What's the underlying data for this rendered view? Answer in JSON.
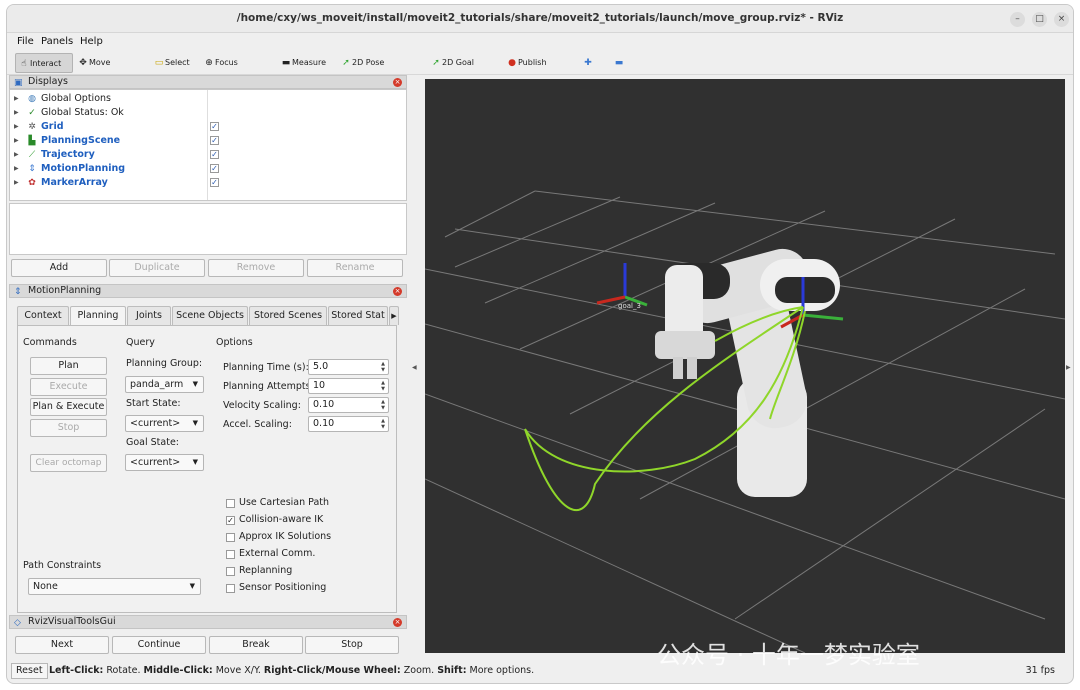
{
  "window": {
    "title": "/home/cxy/ws_moveit/install/moveit2_tutorials/share/moveit2_tutorials/launch/move_group.rviz* - RViz",
    "controls": [
      "–",
      "□",
      "×"
    ]
  },
  "menu": {
    "file": "File",
    "panels": "Panels",
    "help": "Help"
  },
  "toolbar": {
    "interact": "Interact",
    "move_camera": "Move Camera",
    "select": "Select",
    "focus_camera": "Focus Camera",
    "measure": "Measure",
    "pose_estimate": "2D Pose Estimate",
    "goal_pose": "2D Goal Pose",
    "publish_point": "Publish Point"
  },
  "displays": {
    "title": "Displays",
    "items": [
      {
        "label": "Global Options",
        "icon": "globe-icon",
        "blue": false,
        "checked": null
      },
      {
        "label": "Global Status: Ok",
        "icon": "check-icon",
        "blue": false,
        "checked": null
      },
      {
        "label": "Grid",
        "icon": "grid-icon",
        "blue": true,
        "checked": true
      },
      {
        "label": "PlanningScene",
        "icon": "scene-icon",
        "blue": true,
        "checked": true
      },
      {
        "label": "Trajectory",
        "icon": "trajectory-icon",
        "blue": true,
        "checked": true
      },
      {
        "label": "MotionPlanning",
        "icon": "motion-icon",
        "blue": true,
        "checked": true
      },
      {
        "label": "MarkerArray",
        "icon": "marker-icon",
        "blue": true,
        "checked": true
      }
    ],
    "buttons": {
      "add": "Add",
      "duplicate": "Duplicate",
      "remove": "Remove",
      "rename": "Rename"
    }
  },
  "motion_planning": {
    "title": "MotionPlanning",
    "tabs": [
      "Context",
      "Planning",
      "Joints",
      "Scene Objects",
      "Stored Scenes",
      "Stored Stat"
    ],
    "active_tab": "Planning",
    "commands": {
      "heading": "Commands",
      "plan": "Plan",
      "execute": "Execute",
      "plan_execute": "Plan & Execute",
      "stop": "Stop",
      "clear_octomap": "Clear octomap"
    },
    "query": {
      "heading": "Query",
      "planning_group_label": "Planning Group:",
      "planning_group": "panda_arm",
      "start_state_label": "Start State:",
      "start_state": "<current>",
      "goal_state_label": "Goal State:",
      "goal_state": "<current>"
    },
    "options": {
      "heading": "Options",
      "planning_time_label": "Planning Time (s):",
      "planning_time": "5.0",
      "planning_attempts_label": "Planning Attempts:",
      "planning_attempts": "10",
      "velocity_scaling_label": "Velocity Scaling:",
      "velocity_scaling": "0.10",
      "accel_scaling_label": "Accel. Scaling:",
      "accel_scaling": "0.10",
      "checkboxes": [
        {
          "label": "Use Cartesian Path",
          "checked": false
        },
        {
          "label": "Collision-aware IK",
          "checked": true
        },
        {
          "label": "Approx IK Solutions",
          "checked": false
        },
        {
          "label": "External Comm.",
          "checked": false
        },
        {
          "label": "Replanning",
          "checked": false
        },
        {
          "label": "Sensor Positioning",
          "checked": false
        }
      ]
    },
    "path_constraints": {
      "label": "Path Constraints",
      "value": "None"
    }
  },
  "visual_tools": {
    "title": "RvizVisualToolsGui",
    "next": "Next",
    "continue": "Continue",
    "break": "Break",
    "stop": "Stop"
  },
  "viewport": {
    "frame_label": "goal_3"
  },
  "statusbar": {
    "reset": "Reset",
    "b1": "Left-Click:",
    "t1": " Rotate. ",
    "b2": "Middle-Click:",
    "t2": " Move X/Y. ",
    "b3": "Right-Click/Mouse Wheel:",
    "t3": " Zoom. ",
    "b4": "Shift:",
    "t4": " More options.",
    "fps": "31 fps"
  },
  "watermark": "公众号 · 十年一梦实验室",
  "colors": {
    "trajectory": "#8fd62a",
    "viewport_bg": "#303030",
    "grid": "#7a7a7a",
    "link_blue": "#1f5fbf"
  }
}
